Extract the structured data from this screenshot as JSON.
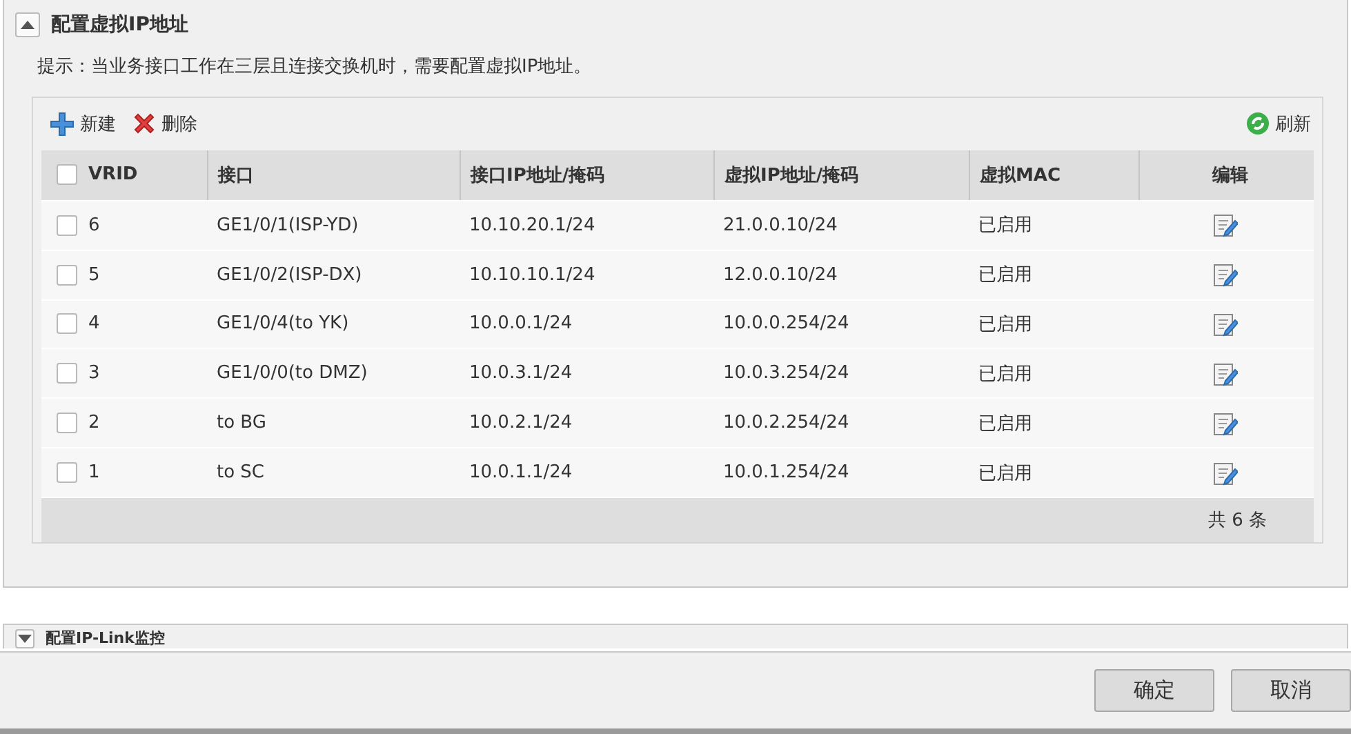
{
  "section": {
    "title": "配置虚拟IP地址",
    "expanded": true,
    "hint": "提示：当业务接口工作在三层且连接交换机时，需要配置虚拟IP地址。"
  },
  "toolbar": {
    "add": "新建",
    "delete": "删除",
    "refresh": "刷新"
  },
  "table": {
    "select_all": false,
    "columns": [
      "VRID",
      "接口",
      "接口IP地址/掩码",
      "虚拟IP地址/掩码",
      "虚拟MAC",
      "编辑"
    ],
    "rows": [
      {
        "checked": false,
        "cells": [
          "6",
          "GE1/0/1(ISP-YD)",
          "10.10.20.1/24",
          "21.0.0.10/24",
          "已启用"
        ]
      },
      {
        "checked": false,
        "cells": [
          "5",
          "GE1/0/2(ISP-DX)",
          "10.10.10.1/24",
          "12.0.0.10/24",
          "已启用"
        ]
      },
      {
        "checked": false,
        "cells": [
          "4",
          "GE1/0/4(to YK)",
          "10.0.0.1/24",
          "10.0.0.254/24",
          "已启用"
        ]
      },
      {
        "checked": false,
        "cells": [
          "3",
          "GE1/0/0(to DMZ)",
          "10.0.3.1/24",
          "10.0.3.254/24",
          "已启用"
        ]
      },
      {
        "checked": false,
        "cells": [
          "2",
          "to BG",
          "10.0.2.1/24",
          "10.0.2.254/24",
          "已启用"
        ]
      },
      {
        "checked": false,
        "cells": [
          "1",
          "to SC",
          "10.0.1.1/24",
          "10.0.1.254/24",
          "已启用"
        ]
      }
    ],
    "total": "共 6 条"
  },
  "next_section": {
    "title": "配置IP-Link监控",
    "expanded": false
  },
  "buttons": [
    "确定",
    "取消"
  ]
}
